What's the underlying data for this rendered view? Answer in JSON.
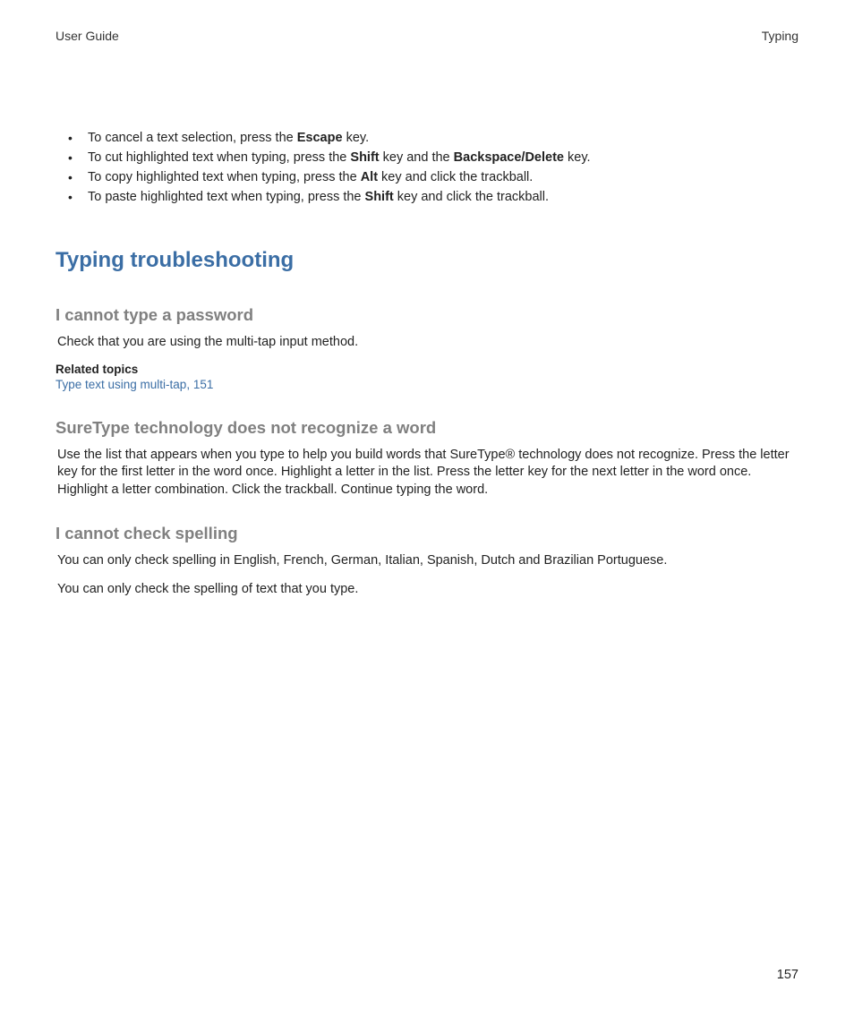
{
  "header": {
    "left": "User Guide",
    "right": "Typing"
  },
  "bullets": [
    {
      "pre": "To cancel a text selection, press the ",
      "b1": "Escape",
      "post1": " key."
    },
    {
      "pre": "To cut highlighted text when typing, press the ",
      "b1": "Shift",
      "mid": " key and the ",
      "b2": "Backspace/Delete",
      "post1": " key."
    },
    {
      "pre": "To copy highlighted text when typing, press the ",
      "b1": "Alt",
      "post1": " key and click the trackball."
    },
    {
      "pre": "To paste highlighted text when typing, press the ",
      "b1": "Shift",
      "post1": " key and click the trackball."
    }
  ],
  "h1": "Typing troubleshooting",
  "sections": {
    "password": {
      "title": "I cannot type a password",
      "body": "Check that you are using the multi-tap input method.",
      "related_label": "Related topics",
      "related_link": "Type text using multi-tap, 151"
    },
    "suretype": {
      "title": "SureType technology does not recognize a word",
      "body": "Use the list that appears when you type to help you build words that SureType® technology does not recognize. Press the letter key for the first letter in the word once. Highlight a letter in the list. Press the letter key for the next letter in the word once. Highlight a letter combination. Click the trackball. Continue typing the word."
    },
    "spelling": {
      "title": "I cannot check spelling",
      "body1": "You can only check spelling in English, French, German, Italian, Spanish, Dutch and Brazilian Portuguese.",
      "body2": "You can only check the spelling of text that you type."
    }
  },
  "page_number": "157"
}
